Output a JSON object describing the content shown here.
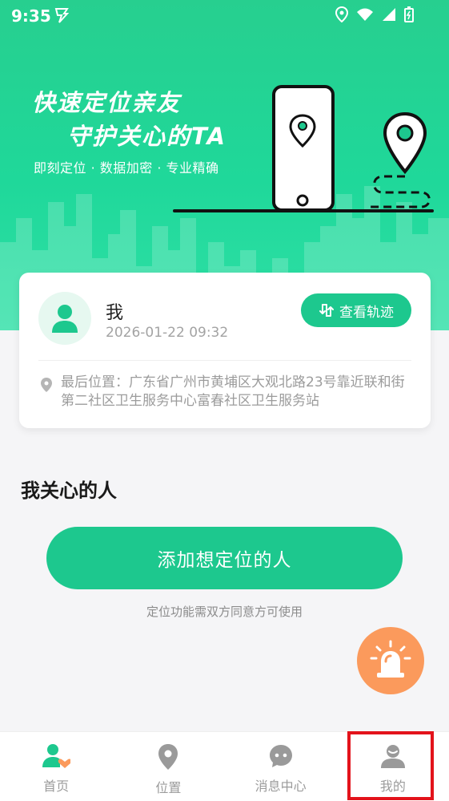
{
  "status_bar": {
    "time": "9:35"
  },
  "hero": {
    "slogan_line1": "快速定位亲友",
    "slogan_line2": "守护关心的TA",
    "features": "即刻定位 · 数据加密 · 专业精确"
  },
  "profile_card": {
    "name": "我",
    "datetime": "2026-01-22 09:32",
    "track_button": "查看轨迹",
    "last_location": "最后位置：广东省广州市黄埔区大观北路23号靠近联和街第二社区卫生服务中心富春社区卫生服务站"
  },
  "care_section": {
    "title": "我关心的人",
    "add_button": "添加想定位的人",
    "note": "定位功能需双方同意方可使用"
  },
  "tabbar": {
    "tabs": [
      {
        "label": "首页",
        "icon": "person-heart-icon"
      },
      {
        "label": "位置",
        "icon": "location-pin-icon"
      },
      {
        "label": "消息中心",
        "icon": "chat-bubble-icon"
      },
      {
        "label": "我的",
        "icon": "user-icon"
      }
    ],
    "highlighted_tab": "我的"
  },
  "colors": {
    "primary_green": "#1dc88e",
    "sos_orange": "#fb9a5c",
    "highlight_red": "#e3131b"
  }
}
